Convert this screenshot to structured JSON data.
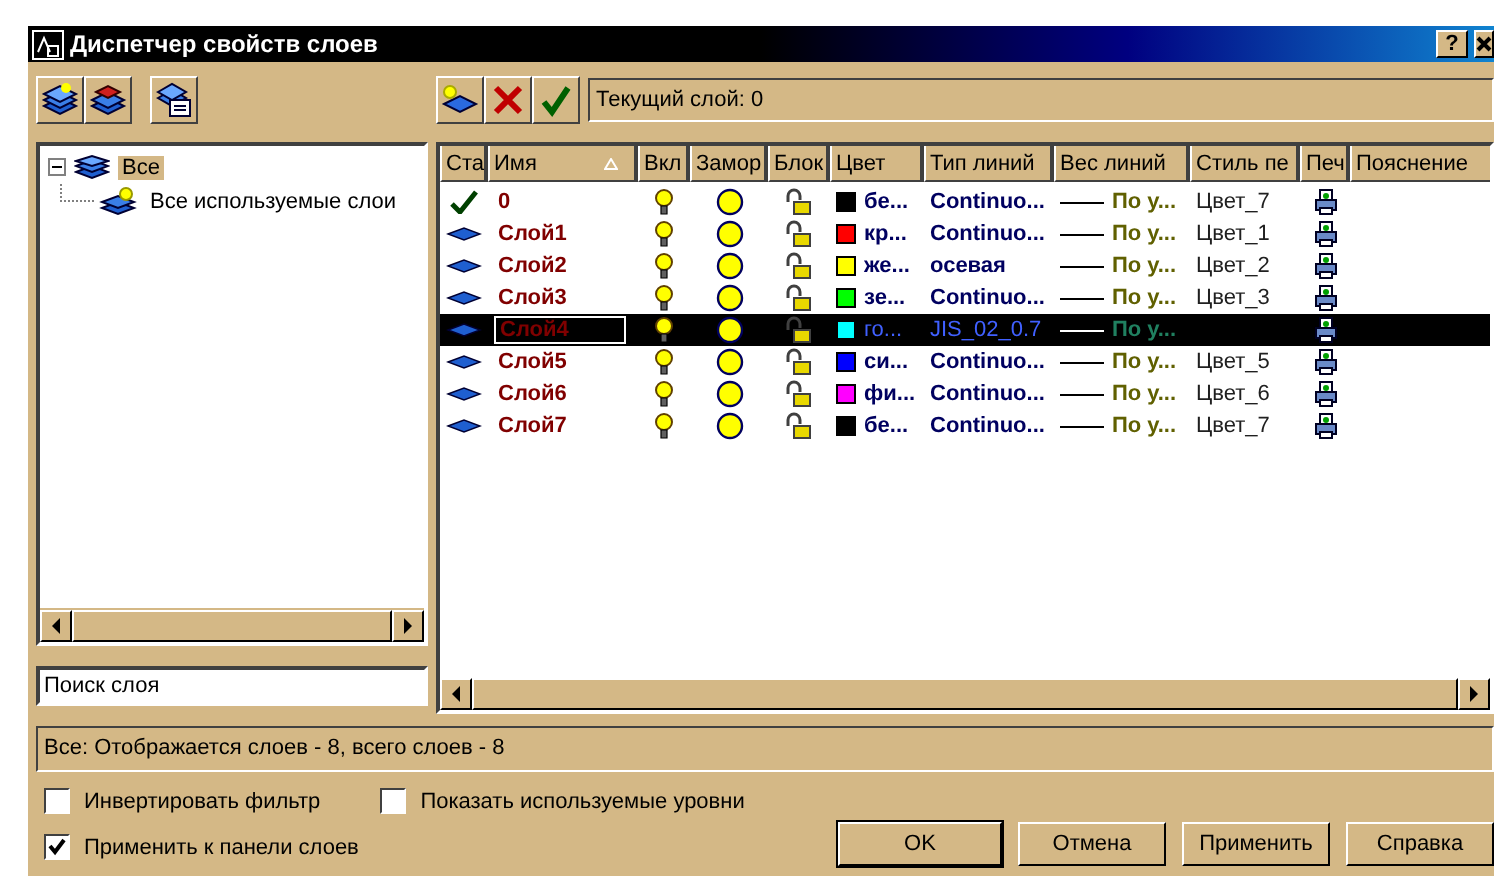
{
  "window": {
    "title": "Диспетчер свойств слоев",
    "help_button": "?"
  },
  "current_layer": "Текущий слой: 0",
  "tree": {
    "items": [
      {
        "label": "Все",
        "selected": true,
        "expanded": true,
        "children": [
          {
            "label": "Все используемые слои",
            "selected": false
          }
        ]
      }
    ]
  },
  "search": {
    "value": "Поиск слоя"
  },
  "table": {
    "columns": [
      "Ста",
      "Имя",
      "Вкл",
      "Замор",
      "Блок",
      "Цвет",
      "Тип линий",
      "Вес линий",
      "Стиль пе",
      "Печ",
      "Пояснение"
    ],
    "rows": [
      {
        "kind": "current",
        "name": "0",
        "on": true,
        "frozen": false,
        "locked": false,
        "color": "#000000",
        "color_name": "бе...",
        "linetype": "Continuo...",
        "lineweight": "По у...",
        "plot_style": "Цвет_7",
        "selected": false
      },
      {
        "kind": "layer",
        "name": "Слой1",
        "on": true,
        "frozen": false,
        "locked": false,
        "color": "#ff0000",
        "color_name": "кр...",
        "linetype": "Continuo...",
        "lineweight": "По у...",
        "plot_style": "Цвет_1",
        "selected": false
      },
      {
        "kind": "layer",
        "name": "Слой2",
        "on": true,
        "frozen": false,
        "locked": false,
        "color": "#ffff00",
        "color_name": "же...",
        "linetype": "осевая",
        "lineweight": "По у...",
        "plot_style": "Цвет_2",
        "selected": false
      },
      {
        "kind": "layer",
        "name": "Слой3",
        "on": true,
        "frozen": false,
        "locked": false,
        "color": "#00ff00",
        "color_name": "зе...",
        "linetype": "Continuo...",
        "lineweight": "По у...",
        "plot_style": "Цвет_3",
        "selected": false
      },
      {
        "kind": "layer",
        "name": "Слой4",
        "on": true,
        "frozen": false,
        "locked": false,
        "color": "#00ffff",
        "color_name": "го...",
        "linetype": "JIS_02_0.7",
        "lineweight": "По у...",
        "selected": true
      },
      {
        "kind": "layer",
        "name": "Слой5",
        "on": true,
        "frozen": false,
        "locked": false,
        "color": "#0000ff",
        "color_name": "си...",
        "linetype": "Continuo...",
        "lineweight": "По у...",
        "plot_style": "Цвет_5",
        "selected": false
      },
      {
        "kind": "layer",
        "name": "Слой6",
        "on": true,
        "frozen": false,
        "locked": false,
        "color": "#ff00ff",
        "color_name": "фи...",
        "linetype": "Continuo...",
        "lineweight": "По у...",
        "plot_style": "Цвет_6",
        "selected": false
      },
      {
        "kind": "layer",
        "name": "Слой7",
        "on": true,
        "frozen": false,
        "locked": false,
        "color": "#000000",
        "color_name": "бе...",
        "linetype": "Continuo...",
        "lineweight": "По у...",
        "plot_style": "Цвет_7",
        "selected": false
      }
    ]
  },
  "status_bar": "Все: Отображается слоев - 8, всего слоев - 8",
  "options": [
    {
      "label": "Инвертировать фильтр",
      "checked": false
    },
    {
      "label": "Показать используемые уровни",
      "checked": false
    },
    {
      "label": "Применить к панели слоев",
      "checked": true
    }
  ],
  "buttons": [
    "OK",
    "Отмена",
    "Применить",
    "Справка"
  ]
}
